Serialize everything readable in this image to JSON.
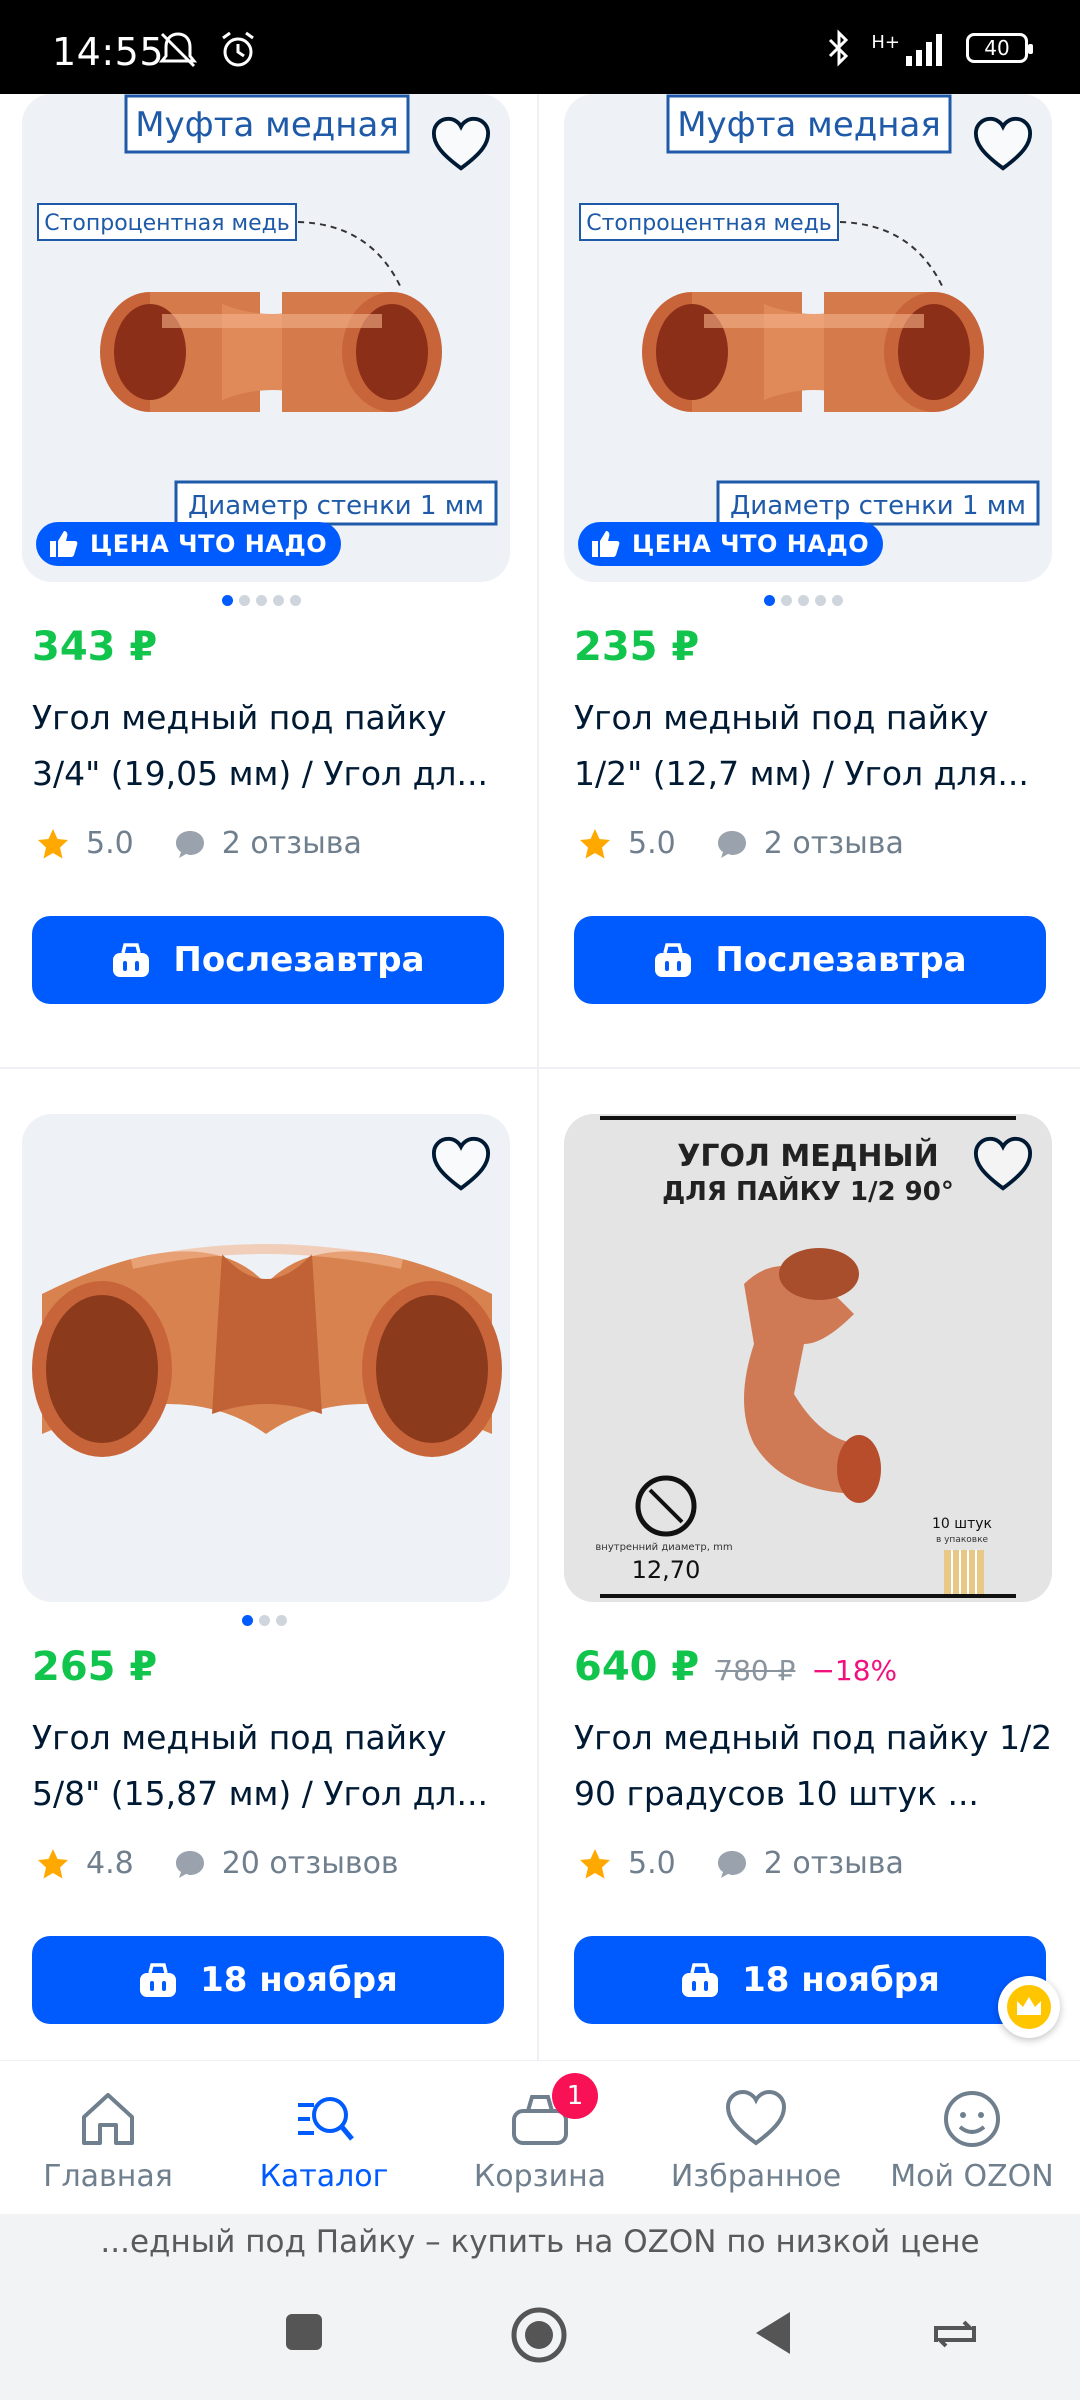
{
  "status_bar": {
    "time": "14:55",
    "network": "H+",
    "battery": "40"
  },
  "products": [
    {
      "image_heading": "Муфта медная",
      "image_label_top": "Стопроцентная медь",
      "image_label_bottom": "Диаметр стенки 1 мм",
      "promo_badge": "ЦЕНА ЧТО НАДО",
      "price": "343 ₽",
      "title": "Угол медный под пайку 3/4\" (19,05 мм) / Угол дл...",
      "rating": "5.0",
      "reviews": "2 отзыва",
      "button": "Послезавтра"
    },
    {
      "image_heading": "Муфта медная",
      "image_label_top": "Стопроцентная медь",
      "image_label_bottom": "Диаметр стенки 1 мм",
      "promo_badge": "ЦЕНА ЧТО НАДО",
      "price": "235 ₽",
      "title": "Угол медный под пайку 1/2\" (12,7 мм) / Угол для...",
      "rating": "5.0",
      "reviews": "2 отзыва",
      "button": "Послезавтра"
    },
    {
      "price": "265 ₽",
      "title": "Угол медный под пайку 5/8\" (15,87 мм) / Угол дл...",
      "rating": "4.8",
      "reviews": "20 отзывов",
      "button": "18 ноября"
    },
    {
      "image_heading_1": "УГОЛ МЕДНЫЙ",
      "image_heading_2": "ДЛЯ ПАЙКУ 1/2 90°",
      "image_label_diam": "внутренний диаметр, mm",
      "image_diam_value": "12,70",
      "image_label_pack": "10 штук",
      "image_label_pack_sub": "в упаковке",
      "price": "640 ₽",
      "old_price": "780 ₽",
      "discount": "−18%",
      "title": "Угол медный под пайку 1/2 90 градусов 10 штук ...",
      "rating": "5.0",
      "reviews": "2 отзыва",
      "button": "18 ноября"
    }
  ],
  "tabbar": {
    "home": "Главная",
    "catalog": "Каталог",
    "cart": "Корзина",
    "cart_count": "1",
    "favorites": "Избранное",
    "profile": "Мой OZON"
  },
  "page_title_bar": "...едный под Пайку – купить на OZON по низкой цене",
  "colors": {
    "accent": "#005bff",
    "price": "#10c44c",
    "discount": "#f1117e",
    "copper": "#c8643a"
  }
}
